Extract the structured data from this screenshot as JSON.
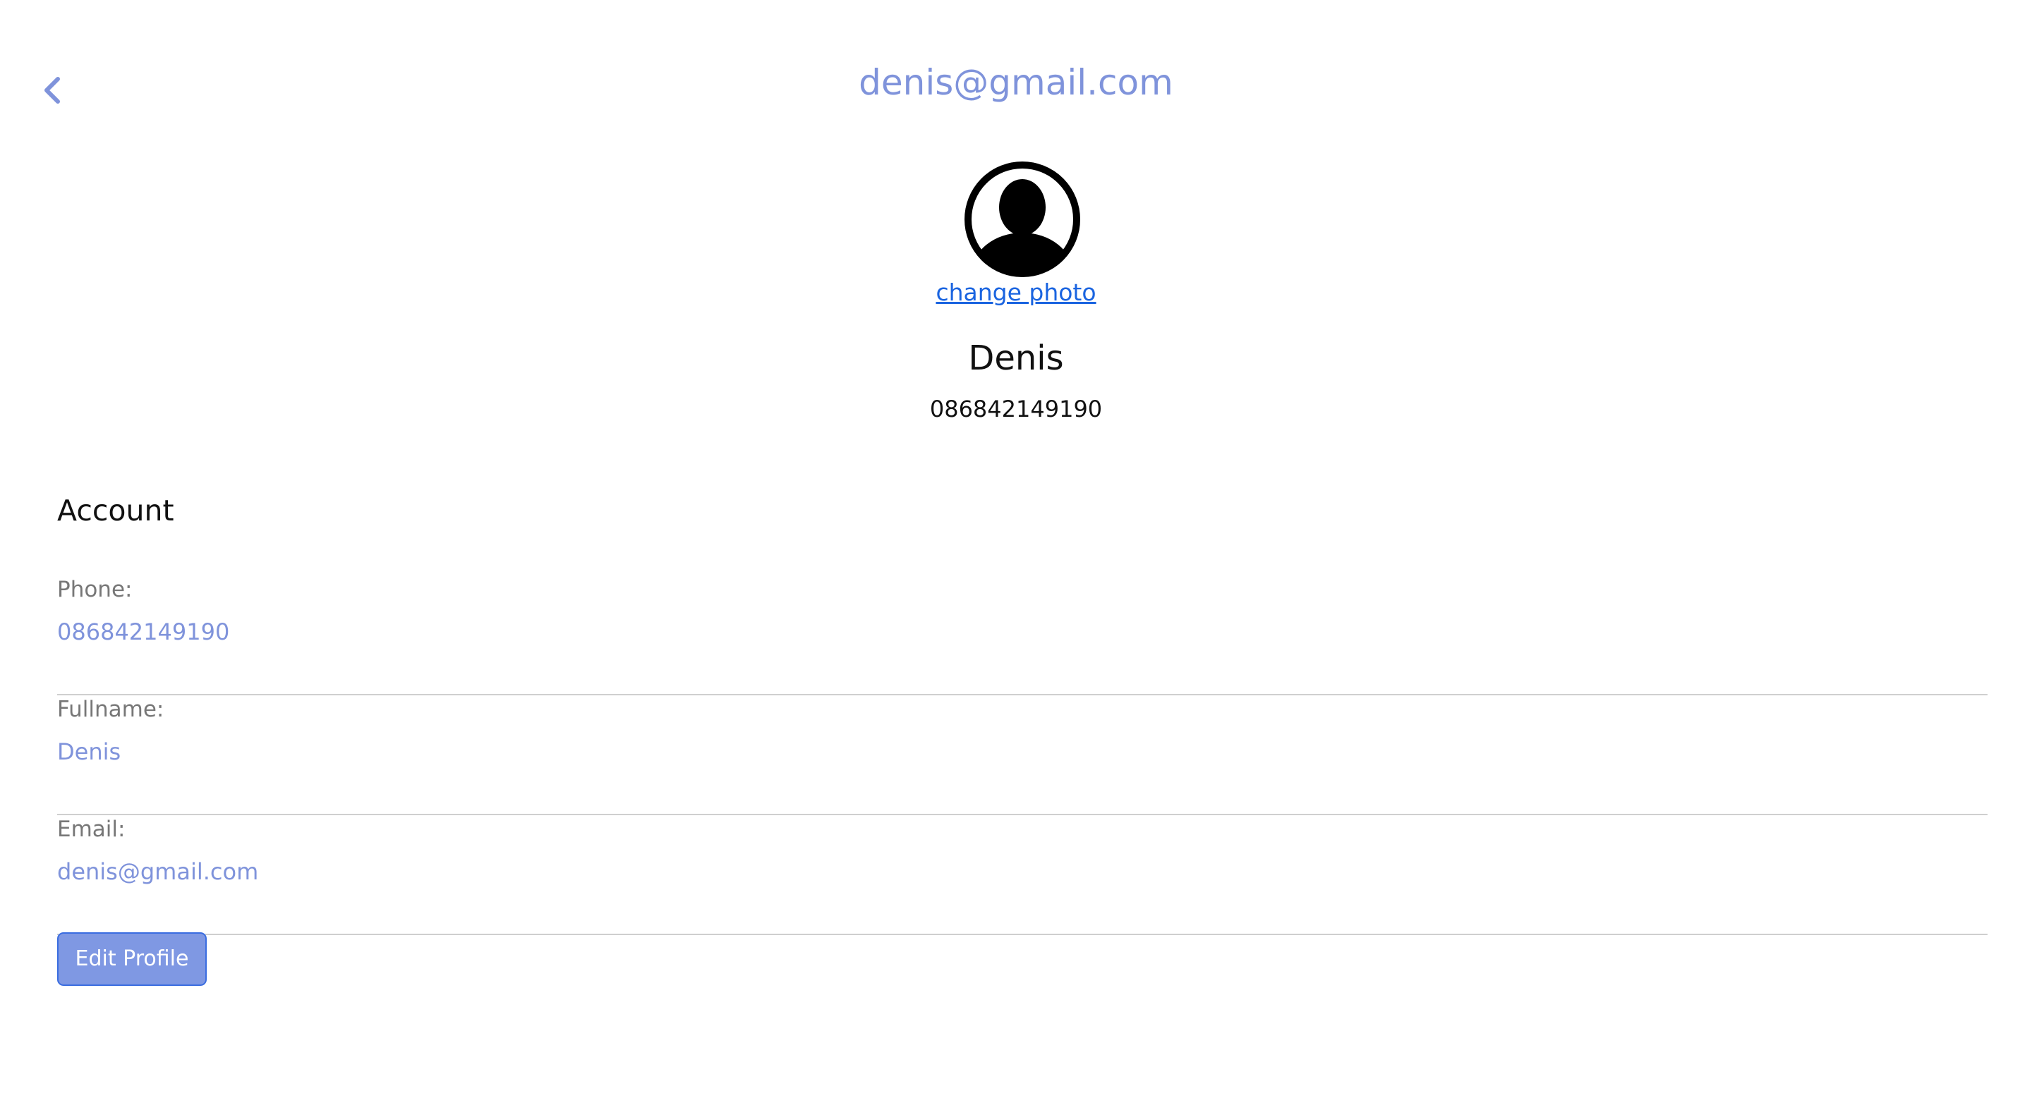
{
  "header": {
    "title": "denis@gmail.com",
    "back_icon": "chevron-left-icon"
  },
  "profile": {
    "avatar_icon": "user-circle-icon",
    "change_photo_label": "change photo",
    "name": "Denis",
    "phone": "086842149190"
  },
  "account": {
    "title": "Account",
    "fields": [
      {
        "label": "Phone:",
        "value": "086842149190"
      },
      {
        "label": "Fullname:",
        "value": "Denis"
      },
      {
        "label": "Email:",
        "value": "denis@gmail.com"
      }
    ]
  },
  "actions": {
    "edit_profile_label": "Edit Profile"
  },
  "colors": {
    "accent": "#7f93db",
    "link": "#1a64e0",
    "button_bg": "#7f98e3",
    "button_border": "#3a6de0",
    "divider": "#cfcfcf",
    "label": "#777777",
    "text": "#111111"
  }
}
